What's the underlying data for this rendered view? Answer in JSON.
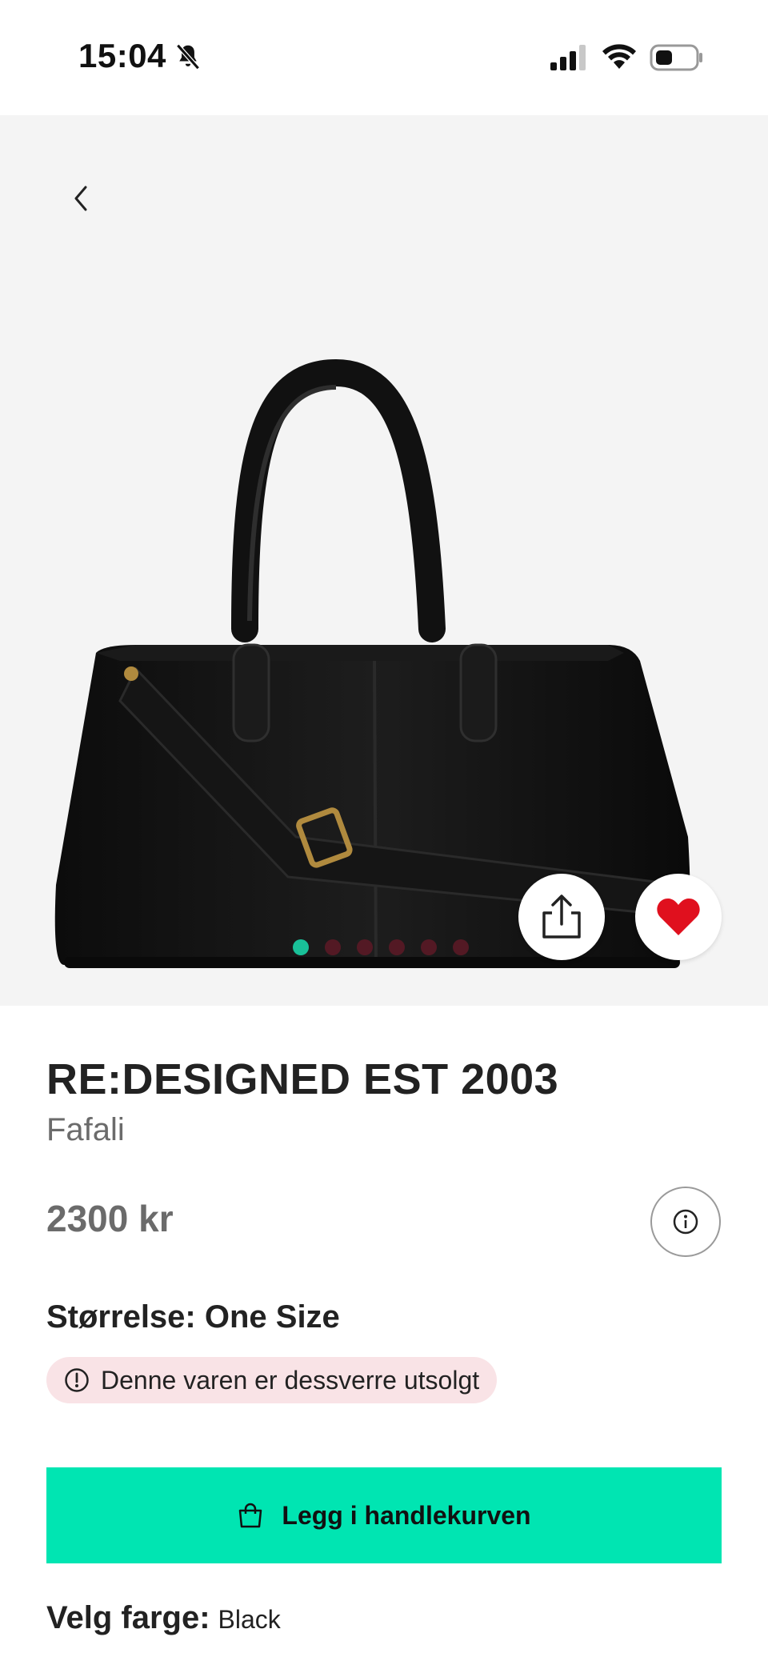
{
  "status_bar": {
    "time": "15:04",
    "icons": [
      "bell-slash-icon",
      "signal-icon",
      "wifi-icon",
      "battery-icon"
    ]
  },
  "gallery": {
    "image_count": 6,
    "active_index": 0,
    "active_dot_color": "#19d3a6",
    "inactive_dot_color": "#5a1a26"
  },
  "product": {
    "brand": "RE:DESIGNED EST 2003",
    "name": "Fafali",
    "price": "2300 kr",
    "size_text": "Størrelse: One Size",
    "soldout_text": "Denne varen er dessverre utsolgt",
    "favorite": true
  },
  "actions": {
    "add_to_cart_label": "Legg i handlekurven"
  },
  "color": {
    "label": "Velg farge:",
    "value": "Black"
  },
  "colors": {
    "accent": "#00e5b2",
    "heart": "#e0101e",
    "soldout_bg": "#f9e3e6"
  }
}
